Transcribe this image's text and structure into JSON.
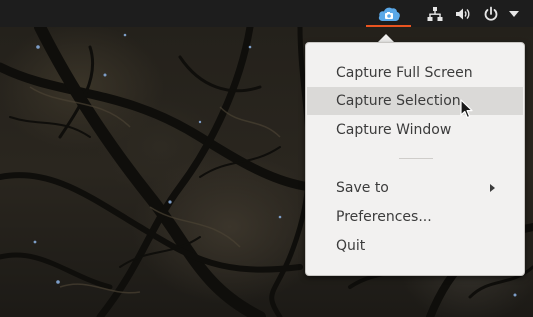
{
  "top_bar": {
    "indicators": [
      {
        "name": "screenshot",
        "icon": "camera-cloud-icon",
        "active": true,
        "accent": "#e95420",
        "icon_color": "#5aa8e8"
      },
      {
        "name": "network",
        "icon": "network-wired-icon"
      },
      {
        "name": "volume",
        "icon": "speaker-volume-icon"
      },
      {
        "name": "power",
        "icon": "power-icon"
      },
      {
        "name": "system-menu",
        "icon": "chevron-down-icon"
      }
    ]
  },
  "menu": {
    "items": [
      {
        "label": "Capture Full Screen"
      },
      {
        "label": "Capture Selection",
        "highlighted": true
      },
      {
        "label": "Capture Window"
      },
      {
        "label": "Save to",
        "has_submenu": true
      },
      {
        "label": "Preferences..."
      },
      {
        "label": "Quit"
      }
    ],
    "background": "#f2f1f0",
    "hover_background": "#dad9d7",
    "text_color": "#3c3c3c"
  }
}
